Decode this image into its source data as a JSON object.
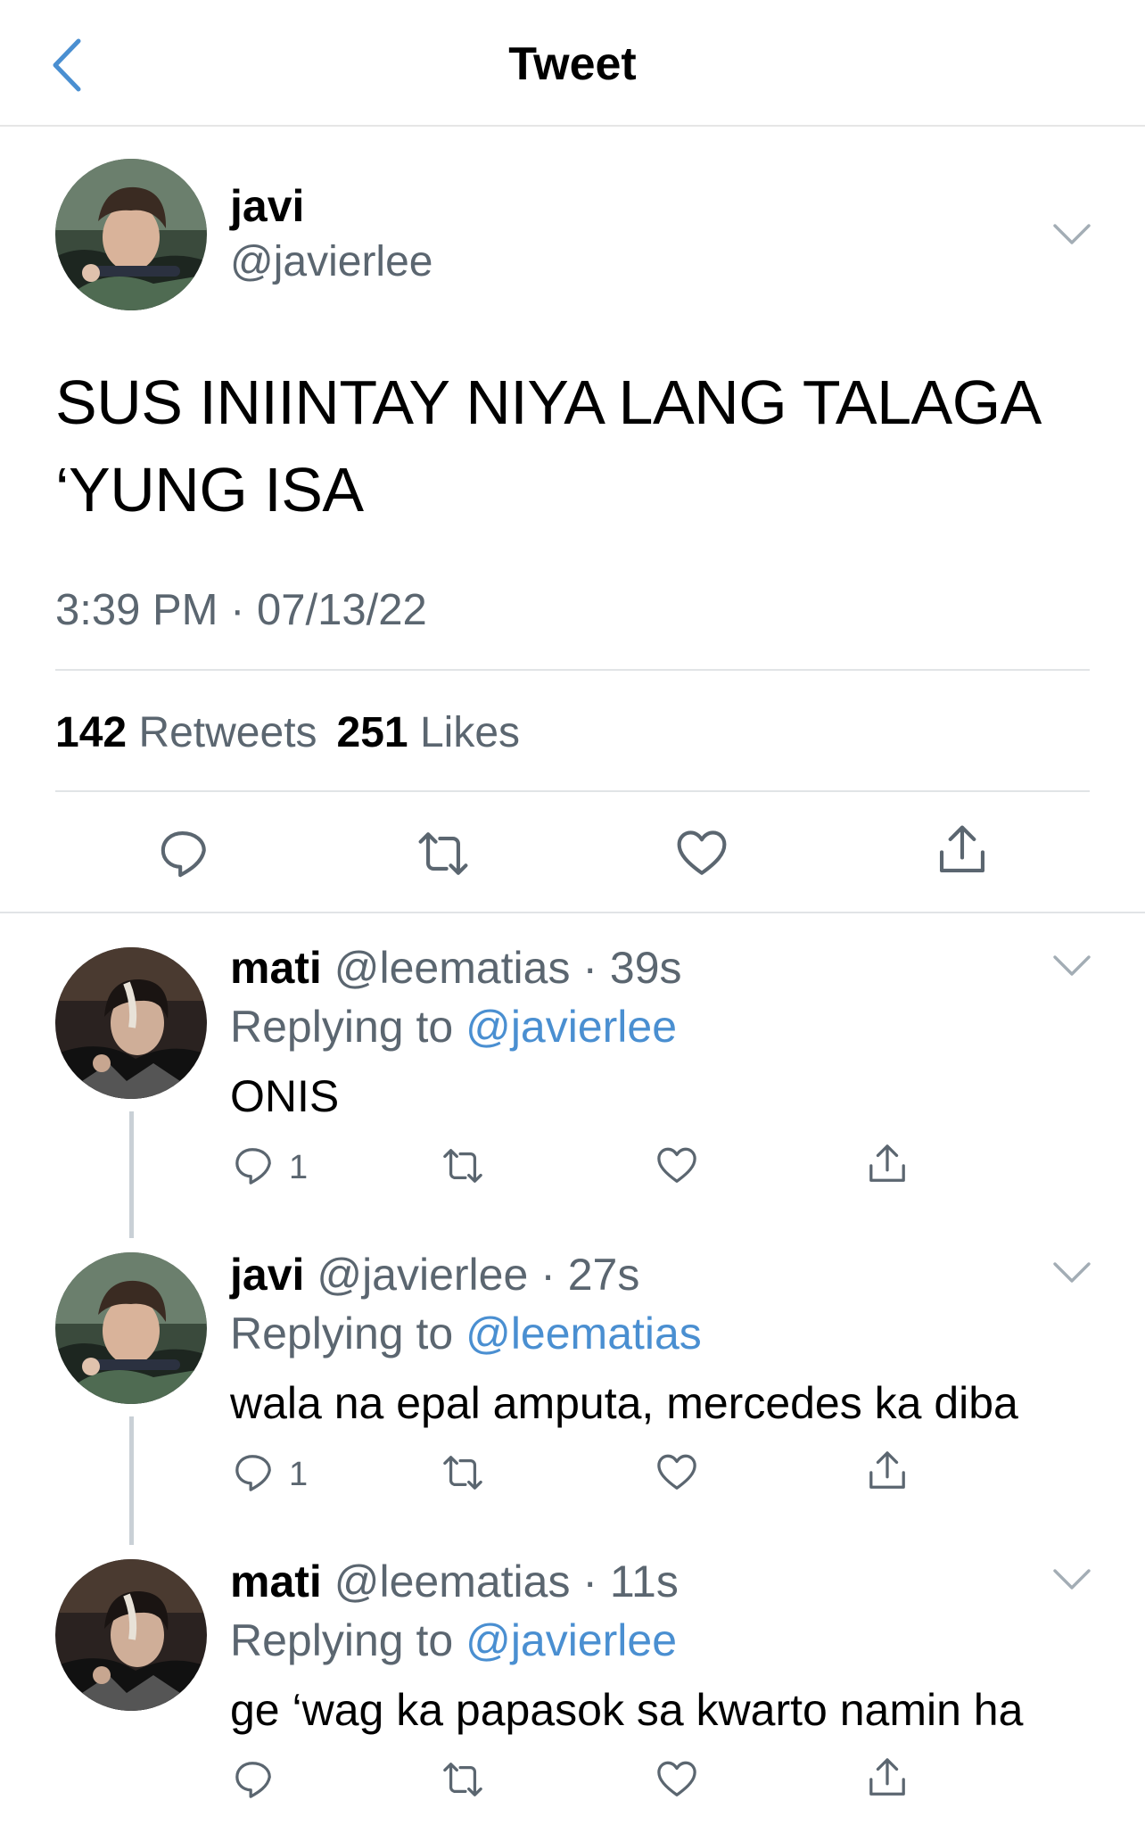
{
  "header": {
    "title": "Tweet"
  },
  "tweet": {
    "name": "javi",
    "handle": "@javierlee",
    "text_line1": "SUS INIINTAY NIYA LANG TALAGA",
    "text_line2": "‘YUNG ISA",
    "timestamp": "3:39 PM · 07/13/22",
    "retweet_count": "142",
    "retweet_label": "Retweets",
    "like_count": "251",
    "like_label": "Likes"
  },
  "replies": [
    {
      "name": "mati",
      "handle": "@leematias",
      "time": "· 39s",
      "replying_prefix": "Replying to",
      "replying_to": "@javierlee",
      "text": "ONIS",
      "reply_count": "1"
    },
    {
      "name": "javi",
      "handle": "@javierlee",
      "time": "· 27s",
      "replying_prefix": "Replying to",
      "replying_to": "@leematias",
      "text": "wala na epal amputa, mercedes ka diba",
      "reply_count": "1"
    },
    {
      "name": "mati",
      "handle": "@leematias",
      "time": "· 11s",
      "replying_prefix": "Replying to",
      "replying_to": "@javierlee",
      "text": "ge ‘wag ka papasok sa kwarto namin ha",
      "reply_count": ""
    }
  ],
  "colors": {
    "accent": "#4a8fd1",
    "secondary_text": "#5b6670",
    "divider": "#e1e4e6"
  },
  "icons": [
    "chevron-left-icon",
    "chevron-down-icon",
    "reply-icon",
    "retweet-icon",
    "like-icon",
    "share-icon"
  ]
}
